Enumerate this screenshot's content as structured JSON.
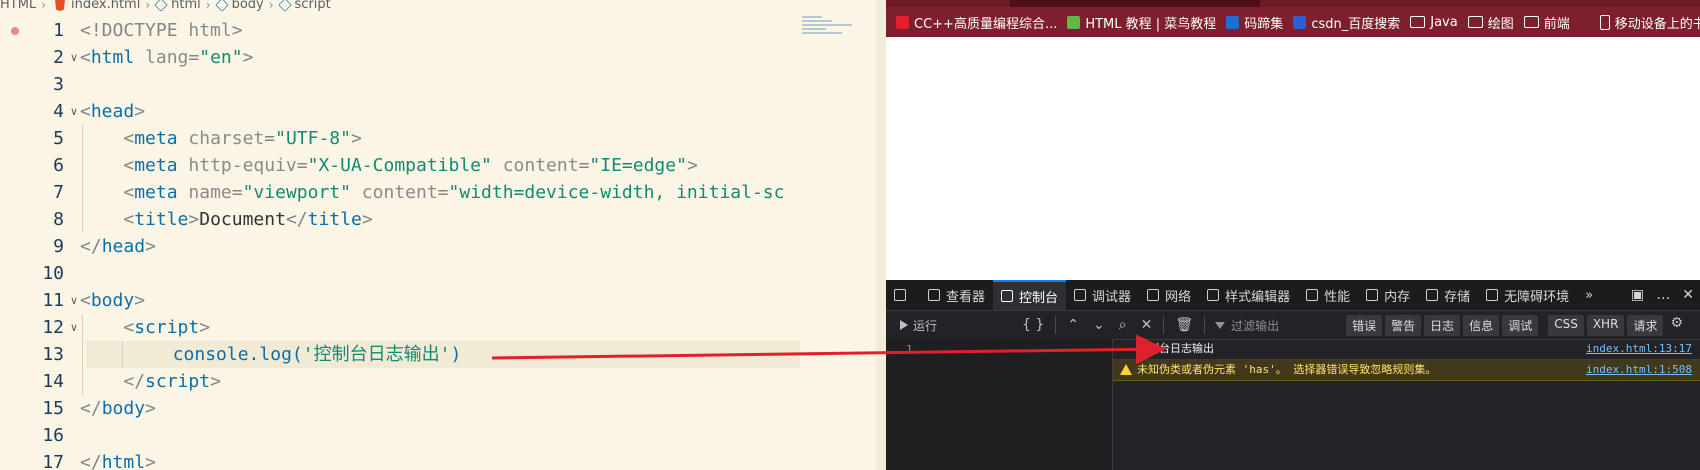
{
  "editor": {
    "breadcrumb": [
      "HTML",
      "index.html",
      "html",
      "body",
      "script"
    ],
    "line_numbers": [
      "1",
      "2",
      "3",
      "4",
      "5",
      "6",
      "7",
      "8",
      "9",
      "10",
      "11",
      "12",
      "13",
      "14",
      "15",
      "16",
      "17"
    ],
    "code_lines": [
      [
        {
          "c": "p",
          "t": "<!DOCTYPE "
        },
        {
          "c": "a",
          "t": "html"
        },
        {
          "c": "p",
          "t": ">"
        }
      ],
      [
        {
          "c": "p",
          "t": "<"
        },
        {
          "c": "k",
          "t": "html"
        },
        {
          "c": "a",
          "t": " lang"
        },
        {
          "c": "p",
          "t": "="
        },
        {
          "c": "s",
          "t": "\"en\""
        },
        {
          "c": "p",
          "t": ">"
        }
      ],
      [],
      [
        {
          "c": "p",
          "t": "<"
        },
        {
          "c": "k",
          "t": "head"
        },
        {
          "c": "p",
          "t": ">"
        }
      ],
      [
        {
          "c": "txt",
          "t": "    "
        },
        {
          "c": "p",
          "t": "<"
        },
        {
          "c": "k",
          "t": "meta"
        },
        {
          "c": "a",
          "t": " charset"
        },
        {
          "c": "p",
          "t": "="
        },
        {
          "c": "s",
          "t": "\"UTF-8\""
        },
        {
          "c": "p",
          "t": ">"
        }
      ],
      [
        {
          "c": "txt",
          "t": "    "
        },
        {
          "c": "p",
          "t": "<"
        },
        {
          "c": "k",
          "t": "meta"
        },
        {
          "c": "a",
          "t": " http-equiv"
        },
        {
          "c": "p",
          "t": "="
        },
        {
          "c": "s",
          "t": "\"X-UA-Compatible\""
        },
        {
          "c": "a",
          "t": " content"
        },
        {
          "c": "p",
          "t": "="
        },
        {
          "c": "s",
          "t": "\"IE=edge\""
        },
        {
          "c": "p",
          "t": ">"
        }
      ],
      [
        {
          "c": "txt",
          "t": "    "
        },
        {
          "c": "p",
          "t": "<"
        },
        {
          "c": "k",
          "t": "meta"
        },
        {
          "c": "a",
          "t": " name"
        },
        {
          "c": "p",
          "t": "="
        },
        {
          "c": "s",
          "t": "\"viewport\""
        },
        {
          "c": "a",
          "t": " content"
        },
        {
          "c": "p",
          "t": "="
        },
        {
          "c": "s",
          "t": "\"width=device-width, initial-sc"
        }
      ],
      [
        {
          "c": "txt",
          "t": "    "
        },
        {
          "c": "p",
          "t": "<"
        },
        {
          "c": "k",
          "t": "title"
        },
        {
          "c": "p",
          "t": ">"
        },
        {
          "c": "txt",
          "t": "Document"
        },
        {
          "c": "p",
          "t": "</"
        },
        {
          "c": "k",
          "t": "title"
        },
        {
          "c": "p",
          "t": ">"
        }
      ],
      [
        {
          "c": "p",
          "t": "</"
        },
        {
          "c": "k",
          "t": "head"
        },
        {
          "c": "p",
          "t": ">"
        }
      ],
      [],
      [
        {
          "c": "p",
          "t": "<"
        },
        {
          "c": "k",
          "t": "body"
        },
        {
          "c": "p",
          "t": ">"
        }
      ],
      [
        {
          "c": "txt",
          "t": "    "
        },
        {
          "c": "p",
          "t": "<"
        },
        {
          "c": "k",
          "t": "script"
        },
        {
          "c": "p",
          "t": ">"
        }
      ],
      [
        {
          "c": "txt",
          "t": "        "
        },
        {
          "c": "fn",
          "t": "console.log("
        },
        {
          "c": "s",
          "t": "'控制台日志输出'"
        },
        {
          "c": "fn",
          "t": ")"
        }
      ],
      [
        {
          "c": "txt",
          "t": "    "
        },
        {
          "c": "p",
          "t": "</"
        },
        {
          "c": "k",
          "t": "script"
        },
        {
          "c": "p",
          "t": ">"
        }
      ],
      [
        {
          "c": "p",
          "t": "</"
        },
        {
          "c": "k",
          "t": "body"
        },
        {
          "c": "p",
          "t": ">"
        }
      ],
      [],
      [
        {
          "c": "p",
          "t": "</"
        },
        {
          "c": "k",
          "t": "html"
        },
        {
          "c": "p",
          "t": ">"
        }
      ]
    ],
    "current_line": 13,
    "breakpoint_line": 1,
    "folded_lines": [
      2,
      4,
      11,
      12
    ]
  },
  "browser": {
    "bookmarks": [
      {
        "icon": "csdn-icon",
        "label": "CC++高质量编程综合..."
      },
      {
        "icon": "runoob-icon",
        "label": "HTML 教程 | 菜鸟教程"
      },
      {
        "icon": "code-icon",
        "label": "码蹄集"
      },
      {
        "icon": "baidu-icon",
        "label": "csdn_百度搜索"
      },
      {
        "icon": "folder-icon",
        "label": "Java"
      },
      {
        "icon": "folder-icon",
        "label": "绘图"
      },
      {
        "icon": "folder-icon",
        "label": "前端"
      },
      {
        "icon": "mobile-icon",
        "label": "移动设备上的书签"
      }
    ],
    "devtools": {
      "tabs": [
        {
          "label": "查看器",
          "icon": "inspector-icon"
        },
        {
          "label": "控制台",
          "icon": "console-icon",
          "active": true
        },
        {
          "label": "调试器",
          "icon": "debugger-icon"
        },
        {
          "label": "网络",
          "icon": "network-icon"
        },
        {
          "label": "样式编辑器",
          "icon": "style-editor-icon"
        },
        {
          "label": "性能",
          "icon": "performance-icon"
        },
        {
          "label": "内存",
          "icon": "memory-icon"
        },
        {
          "label": "存储",
          "icon": "storage-icon"
        },
        {
          "label": "无障碍环境",
          "icon": "accessibility-icon"
        }
      ],
      "run_label": "运行",
      "filter_placeholder": "过滤输出",
      "filters": [
        "错误",
        "警告",
        "日志",
        "信息",
        "调试",
        "CSS",
        "XHR",
        "请求"
      ],
      "editor_line": "1",
      "messages": [
        {
          "type": "log",
          "text": "控制台日志输出",
          "source": "index.html:13:17"
        },
        {
          "type": "warn",
          "text": "未知伪类或者伪元素 'has'。  选择器错误导致忽略规则集。",
          "source": "index.html:1:508"
        }
      ]
    }
  },
  "colors": {
    "titlebar": "#7d1f2c",
    "arrow": "#e0202a",
    "devtools_bg": "#232327",
    "warn_bg": "#42381b"
  }
}
